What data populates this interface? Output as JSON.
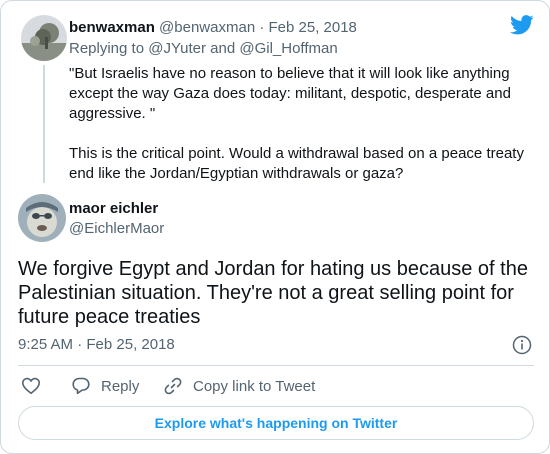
{
  "colors": {
    "accent": "#1d9bf0",
    "muted": "#536471",
    "text": "#0f1419",
    "border": "#cfd9de"
  },
  "parent_tweet": {
    "display_name": "benwaxman",
    "handle": "@benwaxman",
    "separator": "·",
    "date": "Feb 25, 2018",
    "replying_prefix": "Replying to",
    "reply_user_1": "@JYuter",
    "reply_and": "and",
    "reply_user_2": "@Gil_Hoffman",
    "text_paragraph_1": "\"But Israelis have no reason to believe that it will look like anything except the way Gaza does today: militant, despotic, desperate and aggressive. \"",
    "text_paragraph_2": "This is the critical point. Would a withdrawal based on a peace treaty end like the Jordan/Egyptian withdrawals or gaza?"
  },
  "main_tweet": {
    "display_name": "maor eichler",
    "handle": "@EichlerMaor",
    "text": "We forgive Egypt and Jordan for hating us because of the Palestinian situation. They're not a great selling point for future peace treaties",
    "timestamp": "9:25 AM · Feb 25, 2018"
  },
  "actions": {
    "like_icon": "heart-icon",
    "reply_label": "Reply",
    "reply_icon": "speech-bubble-icon",
    "copy_label": "Copy link to Tweet",
    "copy_icon": "link-icon"
  },
  "explore_label": "Explore what's happening on Twitter"
}
